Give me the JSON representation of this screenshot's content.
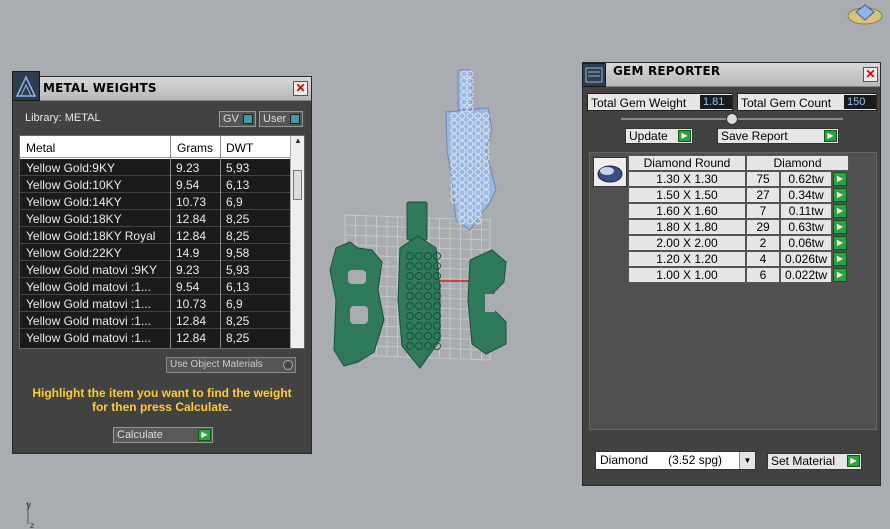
{
  "metal_weights": {
    "title": "METAL WEIGHTS",
    "library_label": "Library: METAL",
    "toggle_gv": "GV",
    "toggle_user": "User",
    "columns": [
      "Metal",
      "Grams",
      "DWT"
    ],
    "rows": [
      {
        "metal": "Yellow Gold:9KY",
        "grams": "9.23",
        "dwt": "5,93"
      },
      {
        "metal": "Yellow Gold:10KY",
        "grams": "9.54",
        "dwt": "6,13"
      },
      {
        "metal": "Yellow Gold:14KY",
        "grams": "10.73",
        "dwt": "6,9"
      },
      {
        "metal": "Yellow Gold:18KY",
        "grams": "12.84",
        "dwt": "8,25"
      },
      {
        "metal": "Yellow Gold:18KY Royal",
        "grams": "12.84",
        "dwt": "8,25"
      },
      {
        "metal": "Yellow Gold:22KY",
        "grams": "14.9",
        "dwt": "9,58"
      },
      {
        "metal": "Yellow Gold matovi :9KY",
        "grams": "9.23",
        "dwt": "5,93"
      },
      {
        "metal": "Yellow Gold matovi :1...",
        "grams": "9.54",
        "dwt": "6,13"
      },
      {
        "metal": "Yellow Gold matovi :1...",
        "grams": "10.73",
        "dwt": "6,9"
      },
      {
        "metal": "Yellow Gold matovi :1...",
        "grams": "12.84",
        "dwt": "8,25"
      },
      {
        "metal": "Yellow Gold matovi :1...",
        "grams": "12.84",
        "dwt": "8,25"
      }
    ],
    "use_object_materials": "Use Object Materials",
    "hint": "Highlight the item you want to find the weight for then press Calculate.",
    "calculate_label": "Calculate"
  },
  "gem_reporter": {
    "title": "GEM REPORTER",
    "total_weight_label": "Total Gem Weight",
    "total_weight_value": "1.81",
    "total_count_label": "Total Gem Count",
    "total_count_value": "150",
    "update_label": "Update",
    "save_report_label": "Save Report",
    "table_headers": [
      "Diamond Round",
      "Diamond"
    ],
    "rows": [
      {
        "size": "1.30 X 1.30",
        "count": "75",
        "weight": "0.62tw"
      },
      {
        "size": "1.50 X 1.50",
        "count": "27",
        "weight": "0.34tw"
      },
      {
        "size": "1.60 X 1.60",
        "count": "7",
        "weight": "0.11tw"
      },
      {
        "size": "1.80 X 1.80",
        "count": "29",
        "weight": "0.63tw"
      },
      {
        "size": "2.00 X 2.00",
        "count": "2",
        "weight": "0.06tw"
      },
      {
        "size": "1.20 X 1.20",
        "count": "4",
        "weight": "0.026tw"
      },
      {
        "size": "1.00 X 1.00",
        "count": "6",
        "weight": "0.022tw"
      }
    ],
    "material_select": "Diamond      (3.52 spg)",
    "set_material_label": "Set Material"
  },
  "viewport": {
    "axis_label": "y",
    "axis_label_z": "z"
  },
  "colors": {
    "viewport_bg": "#a9adb2",
    "panel_bg": "#424242",
    "accent_green": "#29a33a",
    "hint_yellow": "#ffcc33",
    "model_green": "#2f7a5a",
    "model_blue": "#9db8e0"
  }
}
